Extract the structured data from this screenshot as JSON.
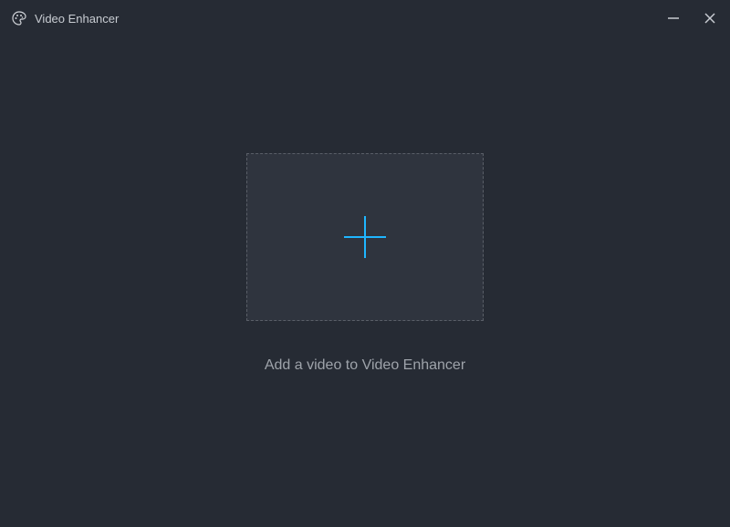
{
  "titlebar": {
    "app_title": "Video Enhancer"
  },
  "main": {
    "instruction_text": "Add a video to Video Enhancer"
  },
  "colors": {
    "accent": "#1fb6ff",
    "background": "#262b34",
    "dropzone_bg": "#2f343e",
    "border": "#5a5f68",
    "text_primary": "#c8ccd2",
    "text_secondary": "#9ea3aa"
  }
}
